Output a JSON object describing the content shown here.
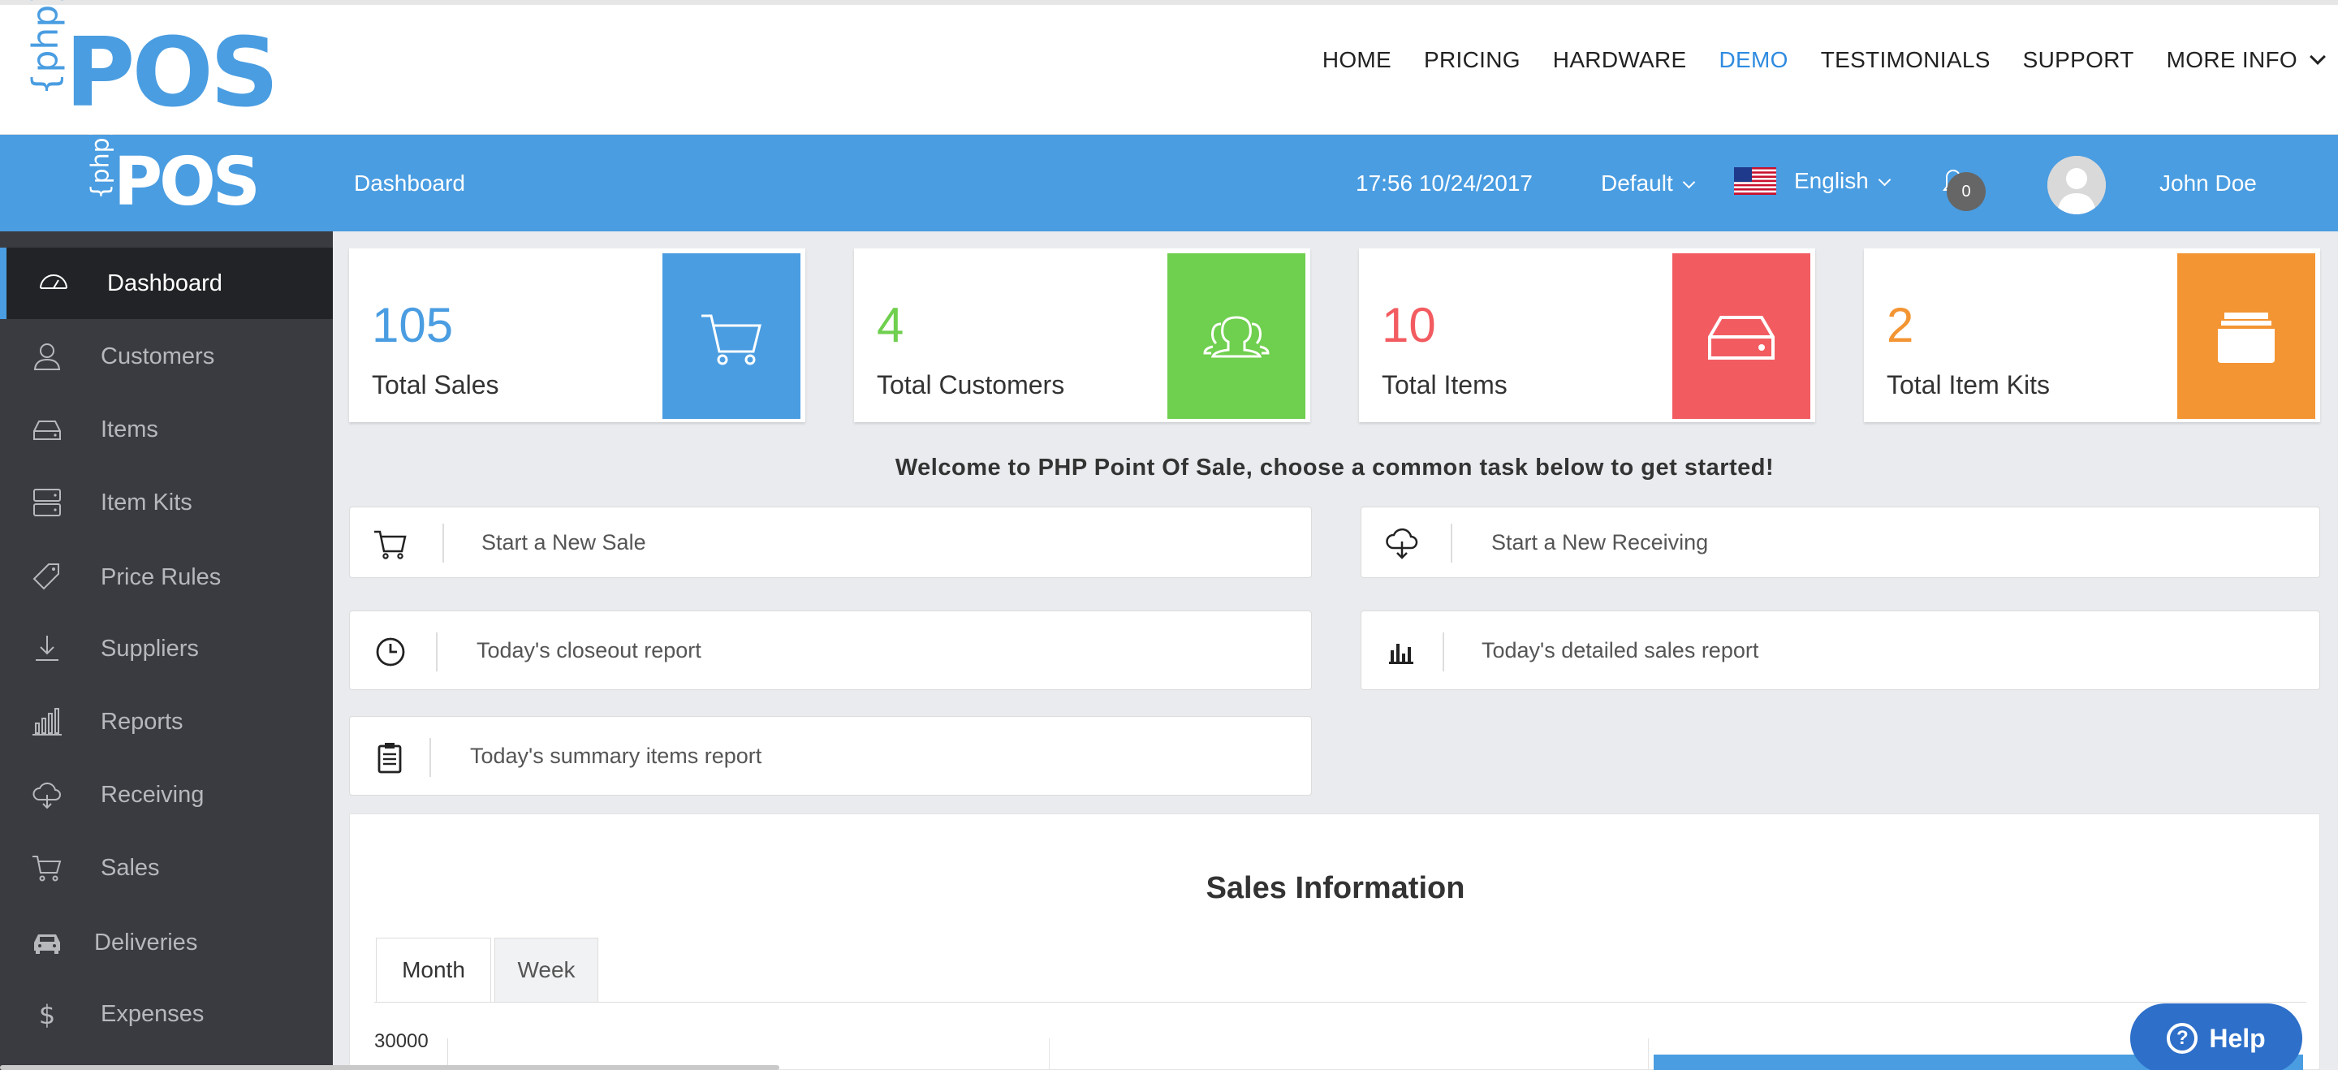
{
  "site_nav": {
    "logo_php": "{php}",
    "logo_pos": "POS",
    "items": [
      "HOME",
      "PRICING",
      "HARDWARE",
      "DEMO",
      "TESTIMONIALS",
      "SUPPORT",
      "MORE INFO"
    ],
    "active": "DEMO"
  },
  "app_header": {
    "logo_php": "{php}",
    "logo_pos": "POS",
    "title": "Dashboard",
    "datetime": "17:56 10/24/2017",
    "location": "Default",
    "language": "English",
    "notifications": "0",
    "user": "John Doe"
  },
  "sidebar": {
    "items": [
      {
        "label": "Dashboard",
        "icon": "dashboard-icon"
      },
      {
        "label": "Customers",
        "icon": "person-icon"
      },
      {
        "label": "Items",
        "icon": "hard-drive-icon"
      },
      {
        "label": "Item Kits",
        "icon": "server-icon"
      },
      {
        "label": "Price Rules",
        "icon": "tag-icon"
      },
      {
        "label": "Suppliers",
        "icon": "download-icon"
      },
      {
        "label": "Reports",
        "icon": "bar-chart-icon"
      },
      {
        "label": "Receiving",
        "icon": "cloud-download-icon"
      },
      {
        "label": "Sales",
        "icon": "cart-icon"
      },
      {
        "label": "Deliveries",
        "icon": "car-icon"
      },
      {
        "label": "Expenses",
        "icon": "dollar-icon"
      }
    ],
    "active": "Dashboard"
  },
  "stats": [
    {
      "value": "105",
      "label": "Total Sales",
      "color": "#4a9de1",
      "icon": "cart-icon"
    },
    {
      "value": "4",
      "label": "Total Customers",
      "color": "#6fcf4e",
      "icon": "group-icon"
    },
    {
      "value": "10",
      "label": "Total Items",
      "color": "#f25c61",
      "icon": "hard-drive-icon"
    },
    {
      "value": "2",
      "label": "Total Item Kits",
      "color": "#f39533",
      "icon": "inbox-icon"
    }
  ],
  "welcome": "Welcome to PHP Point Of Sale, choose a common task below to get started!",
  "tasks": {
    "new_sale": "Start a New Sale",
    "new_receiving": "Start a New Receiving",
    "closeout": "Today's closeout report",
    "detailed_sales": "Today's detailed sales report",
    "summary_items": "Today's summary items report"
  },
  "sales_info": {
    "title": "Sales Information",
    "tabs": [
      "Month",
      "Week"
    ],
    "active_tab": "Month"
  },
  "chart_data": {
    "type": "bar",
    "title": "",
    "y_ticks": [
      "30000"
    ],
    "note": "chart is clipped at the bottom of the screenshot; only the top tick label is visible"
  },
  "help": {
    "label": "Help"
  }
}
